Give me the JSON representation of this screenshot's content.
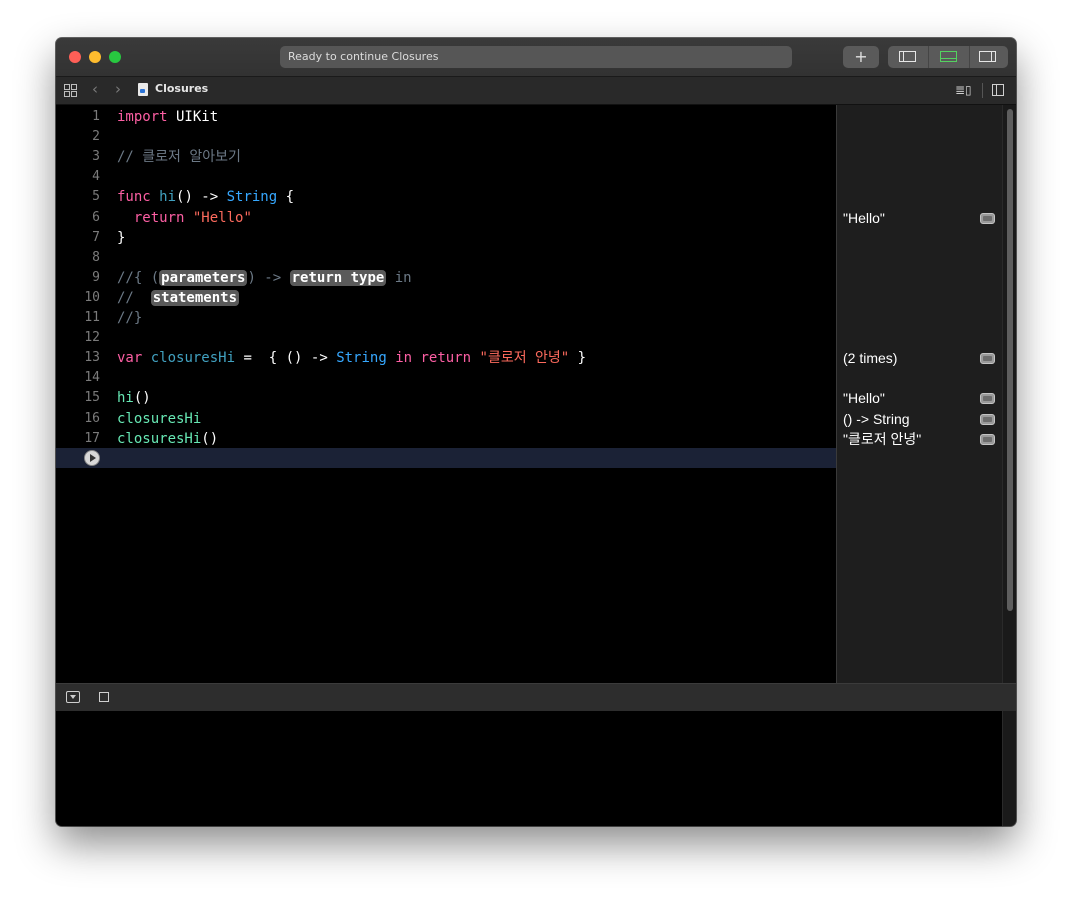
{
  "window": {
    "activity_text": "Ready to continue Closures",
    "add_button": "+"
  },
  "jumpbar": {
    "back": "‹",
    "forward": "›",
    "file_name": "Closures",
    "file_icon": "swift-file-icon"
  },
  "code_lines": [
    {
      "n": "1",
      "html": "<span class=\"kw\">import</span> UIKit"
    },
    {
      "n": "2",
      "html": ""
    },
    {
      "n": "3",
      "html": "<span class=\"cm\">// 클로저 알아보기</span>"
    },
    {
      "n": "4",
      "html": ""
    },
    {
      "n": "5",
      "html": "<span class=\"kw\">func</span> <span class=\"fn\">hi</span>() -> <span class=\"ty\">String</span> {"
    },
    {
      "n": "6",
      "html": "  <span class=\"kw\">return</span> <span class=\"str\">\"Hello\"</span>"
    },
    {
      "n": "7",
      "html": "}"
    },
    {
      "n": "8",
      "html": ""
    },
    {
      "n": "9",
      "html": "<span class=\"cm\">//{ (</span><span class=\"ph\">parameters</span><span class=\"cm\">) -> </span><span class=\"ph\">return type</span><span class=\"cm\"> in</span>"
    },
    {
      "n": "10",
      "html": "<span class=\"cm\">//  </span><span class=\"ph\">statements</span>"
    },
    {
      "n": "11",
      "html": "<span class=\"cm\">//}</span>"
    },
    {
      "n": "12",
      "html": ""
    },
    {
      "n": "13",
      "html": "<span class=\"kw\">var</span> <span class=\"fn\">closuresHi</span> =  { () -> <span class=\"ty\">String</span> <span class=\"kw\">in</span> <span class=\"kw\">return</span> <span class=\"str\">\"클로저 안녕\"</span> }"
    },
    {
      "n": "14",
      "html": ""
    },
    {
      "n": "15",
      "html": "<span class=\"call\">hi</span>()"
    },
    {
      "n": "16",
      "html": "<span class=\"call\">closuresHi</span>"
    },
    {
      "n": "17",
      "html": "<span class=\"call\">closuresHi</span>()"
    }
  ],
  "results": [
    {
      "line": 6,
      "text": "\"Hello\""
    },
    {
      "line": 13,
      "text": "(2 times)"
    },
    {
      "line": 15,
      "text": "\"Hello\""
    },
    {
      "line": 16,
      "text": "() -> String"
    },
    {
      "line": 17,
      "text": "\"클로저 안녕\""
    }
  ]
}
